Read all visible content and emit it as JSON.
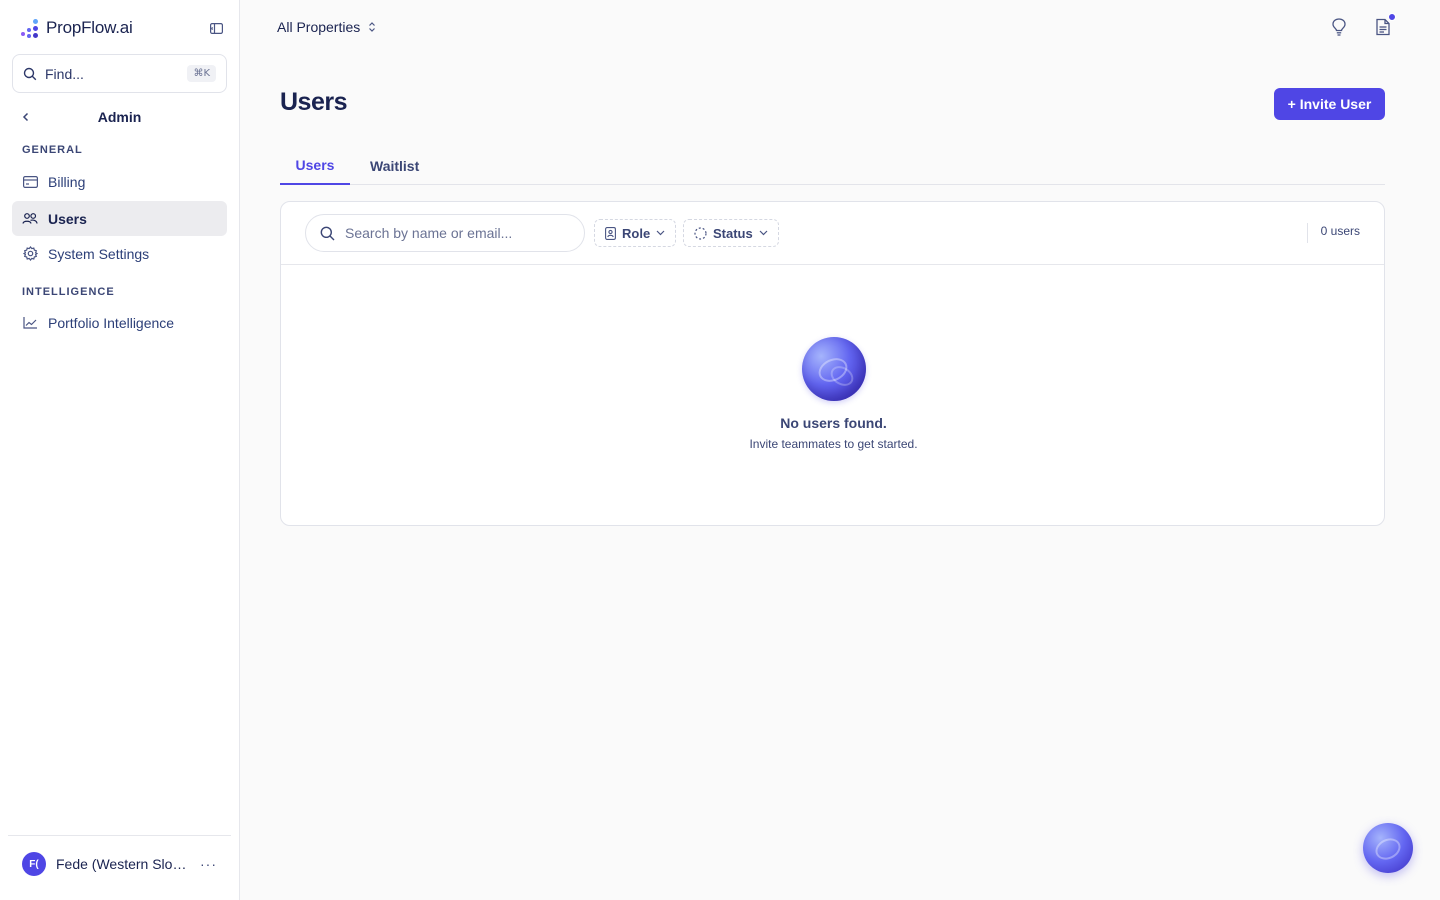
{
  "brand": {
    "name": "PropFlow.ai",
    "accent": "#4f46e5"
  },
  "sidebar": {
    "find": {
      "label": "Find...",
      "shortcut": "⌘K"
    },
    "header": {
      "title": "Admin"
    },
    "sections": [
      {
        "label": "GENERAL"
      },
      {
        "label": "INTELLIGENCE"
      }
    ],
    "items": [
      {
        "label": "Billing",
        "icon": "credit-card-icon"
      },
      {
        "label": "Users",
        "icon": "users-icon",
        "active": true
      },
      {
        "label": "System Settings",
        "icon": "gear-icon"
      },
      {
        "label": "Portfolio Intelligence",
        "icon": "line-chart-icon"
      }
    ],
    "footer": {
      "initials": "F(",
      "name": "Fede (Western Slop..."
    }
  },
  "topbar": {
    "property_selector": "All Properties"
  },
  "page": {
    "title": "Users",
    "invite_label": "+ Invite User",
    "tabs": [
      {
        "label": "Users",
        "active": true
      },
      {
        "label": "Waitlist",
        "active": false
      }
    ]
  },
  "table": {
    "search_placeholder": "Search by name or email...",
    "filters": [
      {
        "label": "Role"
      },
      {
        "label": "Status"
      }
    ],
    "count": "0 users",
    "empty": {
      "title": "No users found.",
      "subtitle": "Invite teammates to get started."
    }
  }
}
